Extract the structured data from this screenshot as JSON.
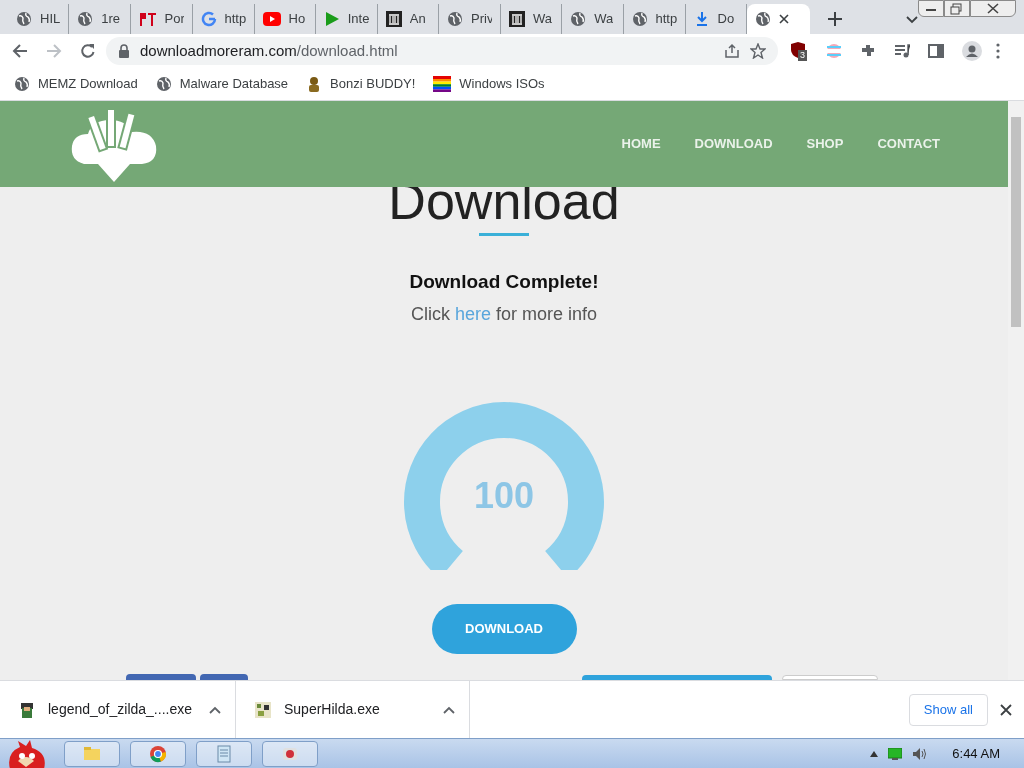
{
  "tabs": [
    {
      "title": "HIL",
      "selected": false
    },
    {
      "title": "1re",
      "selected": false
    },
    {
      "title": "Por",
      "selected": false
    },
    {
      "title": "http",
      "selected": false
    },
    {
      "title": "Ho",
      "selected": false
    },
    {
      "title": "Inte",
      "selected": false
    },
    {
      "title": "An",
      "selected": false
    },
    {
      "title": "Priv",
      "selected": false
    },
    {
      "title": "Wa",
      "selected": false
    },
    {
      "title": "Wa",
      "selected": false
    },
    {
      "title": "http",
      "selected": false
    },
    {
      "title": "Do",
      "selected": false
    },
    {
      "selected": true
    }
  ],
  "address": {
    "host": "downloadmoreram.com",
    "path": "/download.html"
  },
  "extension_badge": "3",
  "bookmarks": [
    {
      "label": "MEMZ Download"
    },
    {
      "label": "Malware Database"
    },
    {
      "label": "Bonzi BUDDY!"
    },
    {
      "label": "Windows ISOs"
    }
  ],
  "site": {
    "nav": [
      "HOME",
      "DOWNLOAD",
      "SHOP",
      "CONTACT"
    ],
    "heading": "Download",
    "status": "Download Complete!",
    "info_before": "Click ",
    "info_link": "here",
    "info_after": " for more info",
    "gauge": {
      "reading": "100"
    },
    "button": "DOWNLOAD"
  },
  "downloads": [
    {
      "file": "legend_of_zilda_....exe"
    },
    {
      "file": "SuperHilda.exe"
    }
  ],
  "show_all": "Show all",
  "taskbar": {
    "clock": "6:44 AM"
  }
}
